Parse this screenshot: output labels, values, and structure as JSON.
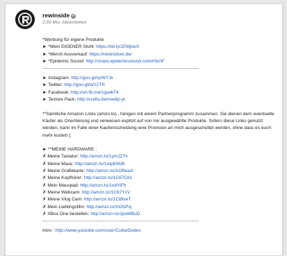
{
  "channel": {
    "name": "rewinside",
    "verified_glyph": "✓",
    "subscribers": "2,93 Mio. Abonnenten",
    "avatar_icon": "rewinside-logo-icon"
  },
  "colors": {
    "link": "#1f5fbf",
    "text": "#222222",
    "muted": "#777777",
    "rule": "#bdbdbd"
  },
  "promo": {
    "heading": "*Werbung für eigene Produkte",
    "items": [
      {
        "bullet": "►",
        "label": "*Mein EIGENER Stuhl:",
        "url": "https://bit.ly/2EMjoeX"
      },
      {
        "bullet": "►",
        "label": "*Merch Ausverkauf:",
        "url": "https://rewinstore.de/"
      },
      {
        "bullet": "►",
        "label": "*Epidemic Sound:",
        "url": "http://share.epidemicsound.com/rNchF"
      }
    ]
  },
  "social": [
    {
      "bullet": "►",
      "label": "Instagram:",
      "url": "http://goo.gl/xpWY1k"
    },
    {
      "bullet": "►",
      "label": "Twitter:",
      "url": "http://goo.gl/taY2TR"
    },
    {
      "bullet": "►",
      "label": "Facebook:",
      "url": "http://on.fb.me/1gw4l74"
    },
    {
      "bullet": "►",
      "label": "Texture Pack:",
      "url": "http://craftu.be/rewitp-yt"
    }
  ],
  "amazon_notice": "**Sämtliche Amazon Links (amzn.to) , hängen mit einem Partnerprogramm zusammen. Sie dienen dem eventuelle Käufer als Orientierung und verweisen explizit auf von mir ausgewählte Produkte. Sofern diese Links genutzt werden, kann im Falle einer Kaufentscheidung eine Provision an mich ausgeschüttet werden, ohne dass es euch mehr kostet! (:",
  "hardware": {
    "heading_bullet": "►",
    "heading": "**MEINE HARDWARE :",
    "items": [
      {
        "bullet": "✗",
        "label": "Meine Tastatur:",
        "url": "http://amzn.to/1ymJZYv"
      },
      {
        "bullet": "✗",
        "label": "Meine Maus:",
        "url": "http://amzn.to/1mpEMd5"
      },
      {
        "bullet": "✗",
        "label": "Meine Grafikkarte:",
        "url": "http://amzn.to/XOReaA"
      },
      {
        "bullet": "✗",
        "label": "Meine Kopfhörer:",
        "url": "http://amzn.to/1C67C61"
      },
      {
        "bullet": "✗",
        "label": "Mein Mauspad:",
        "url": "http://amzn.to/1odYiFh"
      },
      {
        "bullet": "✗",
        "label": "Meine Webcam:",
        "url": "http://amzn.to/1C67YcV"
      },
      {
        "bullet": "✗",
        "label": "Meine Vlog Cam:",
        "url": "http://amzn.to/1C6llveT"
      },
      {
        "bullet": "✗",
        "label": "Mein Lieblingsfilm:",
        "url": "http://amzn.to/XOSPxj"
      },
      {
        "bullet": "✗",
        "label": "XBox One bestellen:",
        "url": "http://amzn.to/1poMBuD"
      }
    ]
  },
  "intro": {
    "label": "Intro :",
    "url": "http://www.youtube.com/user/CubieDudes"
  }
}
